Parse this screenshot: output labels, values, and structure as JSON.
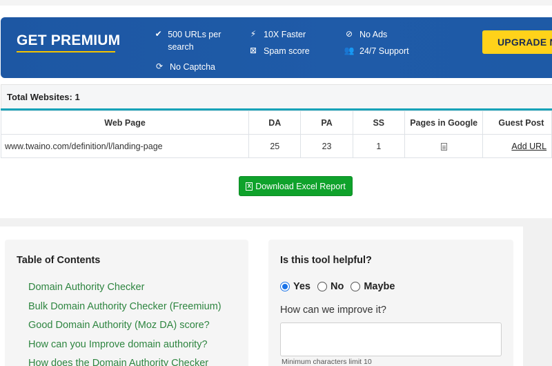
{
  "banner": {
    "title": "GET PREMIUM",
    "features": [
      {
        "icon": "check-icon",
        "text": "500 URLs per search"
      },
      {
        "icon": "refresh-icon",
        "text": "No Captcha"
      },
      {
        "icon": "bolt-icon",
        "text": "10X Faster"
      },
      {
        "icon": "close-box-icon",
        "text": "Spam score"
      },
      {
        "icon": "ban-icon",
        "text": "No Ads"
      },
      {
        "icon": "users-icon",
        "text": "24/7 Support"
      }
    ],
    "upgrade_label": "UPGRADE NOW"
  },
  "results": {
    "total_label": "Total Websites: 1",
    "columns": [
      "Web Page",
      "DA",
      "PA",
      "SS",
      "Pages in Google",
      "Guest Post"
    ],
    "rows": [
      {
        "url": "www.twaino.com/definition/l/landing-page",
        "da": "25",
        "pa": "23",
        "ss": "1",
        "pages_icon": "document-icon",
        "guest_post": "Add URL"
      }
    ],
    "download_label": "Download Excel Report"
  },
  "toc": {
    "title": "Table of Contents",
    "items": [
      "Domain Authority Checker",
      "Bulk Domain Authority Checker (Freemium)",
      "Good Domain Authority (Moz DA) score?",
      "How can you Improve domain authority?",
      "How does the Domain Authority Checker"
    ]
  },
  "feedback": {
    "title": "Is this tool helpful?",
    "options": [
      "Yes",
      "No",
      "Maybe"
    ],
    "selected": "Yes",
    "improve_label": "How can we improve it?",
    "improve_value": "",
    "min_note": "Minimum characters limit 10"
  },
  "colors": {
    "banner_bg": "#1f5ba8",
    "accent_yellow": "#ffd21a",
    "teal": "#17a2b8",
    "download_green": "#0fa22b",
    "toc_link": "#2e8540"
  }
}
